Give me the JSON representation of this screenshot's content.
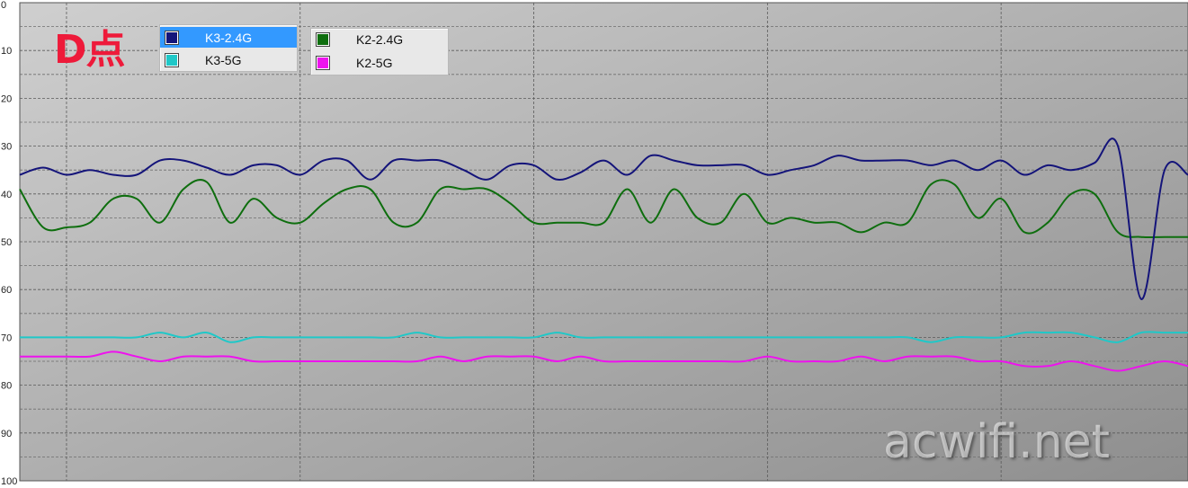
{
  "chart_data": {
    "type": "line",
    "ylim": [
      0,
      100
    ],
    "y_inverted": true,
    "yticks": [
      "0",
      "10",
      "20",
      "30",
      "40",
      "50",
      "60",
      "70",
      "80",
      "90",
      "100"
    ],
    "grid": true,
    "legend_placement": "top-left",
    "x": [
      0,
      2,
      4,
      6,
      8,
      10,
      12,
      14,
      16,
      18,
      20,
      22,
      24,
      26,
      28,
      30,
      32,
      34,
      36,
      38,
      40,
      42,
      44,
      46,
      48,
      50,
      52,
      54,
      56,
      58,
      60,
      62,
      64,
      66,
      68,
      70,
      72,
      74,
      76,
      78,
      80,
      82,
      84,
      86,
      88,
      90,
      92,
      94,
      96,
      98,
      100
    ],
    "series": [
      {
        "name": "K3-2.4G",
        "color": "#14147a",
        "values": [
          36,
          34.5,
          36,
          35,
          36,
          36,
          33,
          33,
          34.5,
          36,
          34,
          34,
          36,
          33,
          33,
          37,
          33,
          33,
          33,
          35,
          37,
          34,
          34,
          37,
          35.5,
          33,
          36,
          32,
          33,
          34,
          34,
          34,
          36,
          35,
          34,
          32,
          33,
          33,
          33,
          34,
          33,
          35,
          33,
          36,
          34,
          35,
          33.5,
          30,
          62,
          35,
          36
        ]
      },
      {
        "name": "K2-2.4G",
        "color": "#0e6e0e",
        "values": [
          39,
          47,
          47,
          46,
          41,
          41,
          46,
          39,
          37.5,
          46,
          41,
          45,
          46,
          42,
          39,
          39,
          46,
          46,
          39,
          39,
          39,
          42,
          46,
          46,
          46,
          46,
          39,
          46,
          39,
          45,
          46,
          40,
          46,
          45,
          46,
          46,
          48,
          46,
          46,
          38,
          38,
          45,
          41,
          48,
          46,
          40,
          40,
          48,
          49,
          49,
          49
        ]
      },
      {
        "name": "K3-5G",
        "color": "#1fc8c8",
        "values": [
          70,
          70,
          70,
          70,
          70,
          70,
          69,
          70,
          69,
          71,
          70,
          70,
          70,
          70,
          70,
          70,
          70,
          69,
          70,
          70,
          70,
          70,
          70,
          69,
          70,
          70,
          70,
          70,
          70,
          70,
          70,
          70,
          70,
          70,
          70,
          70,
          70,
          70,
          70,
          71,
          70,
          70,
          70,
          69,
          69,
          69,
          70,
          71,
          69,
          69,
          69
        ]
      },
      {
        "name": "K2-5G",
        "color": "#ee12ee",
        "values": [
          74,
          74,
          74,
          74,
          73,
          74,
          75,
          74,
          74,
          74,
          75,
          75,
          75,
          75,
          75,
          75,
          75,
          75,
          74,
          75,
          74,
          74,
          74,
          75,
          74,
          75,
          75,
          75,
          75,
          75,
          75,
          75,
          74,
          75,
          75,
          75,
          74,
          75,
          74,
          74,
          74,
          75,
          75,
          76,
          76,
          75,
          76,
          77,
          76,
          75,
          76
        ]
      }
    ]
  },
  "corner_label": "D点",
  "watermark": "acwifi.net"
}
